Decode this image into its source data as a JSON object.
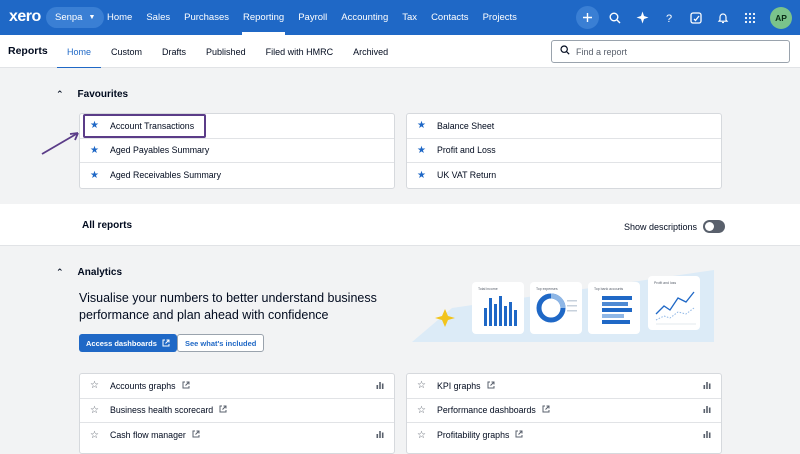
{
  "topnav": {
    "logo": "xero",
    "org": "Senpa",
    "links": [
      "Home",
      "Sales",
      "Purchases",
      "Reporting",
      "Payroll",
      "Accounting",
      "Tax",
      "Contacts",
      "Projects"
    ],
    "active": "Reporting",
    "avatar": "AP",
    "icons": [
      "plus-icon",
      "search-icon",
      "sparkle-icon",
      "help-icon",
      "notes-icon",
      "bell-icon",
      "apps-grid-icon"
    ]
  },
  "subnav": {
    "title": "Reports",
    "tabs": [
      "Home",
      "Custom",
      "Drafts",
      "Published",
      "Filed with HMRC",
      "Archived"
    ],
    "active": "Home",
    "search_placeholder": "Find a report"
  },
  "favourites": {
    "heading": "Favourites",
    "left": [
      "Account Transactions",
      "Aged Payables Summary",
      "Aged Receivables Summary"
    ],
    "right": [
      "Balance Sheet",
      "Profit and Loss",
      "UK VAT Return"
    ]
  },
  "all_reports": {
    "heading": "All reports",
    "show_descriptions": "Show descriptions"
  },
  "analytics": {
    "heading": "Analytics",
    "headline": "Visualise your numbers to better understand business performance and plan ahead with confidence",
    "btn_primary": "Access dashboards",
    "btn_secondary": "See what's included",
    "left": [
      {
        "label": "Accounts graphs",
        "chart": true
      },
      {
        "label": "Business health scorecard",
        "chart": false
      },
      {
        "label": "Cash flow manager",
        "chart": true
      }
    ],
    "right": [
      {
        "label": "KPI graphs",
        "chart": true
      },
      {
        "label": "Performance dashboards",
        "chart": true
      },
      {
        "label": "Profitability graphs",
        "chart": true
      }
    ],
    "illus_cards": [
      "Total income",
      "Top expenses",
      "Top bank accounts",
      "Profit and loss"
    ]
  },
  "colors": {
    "brand_blue": "#1f68c6",
    "highlight": "#5b3c88"
  }
}
